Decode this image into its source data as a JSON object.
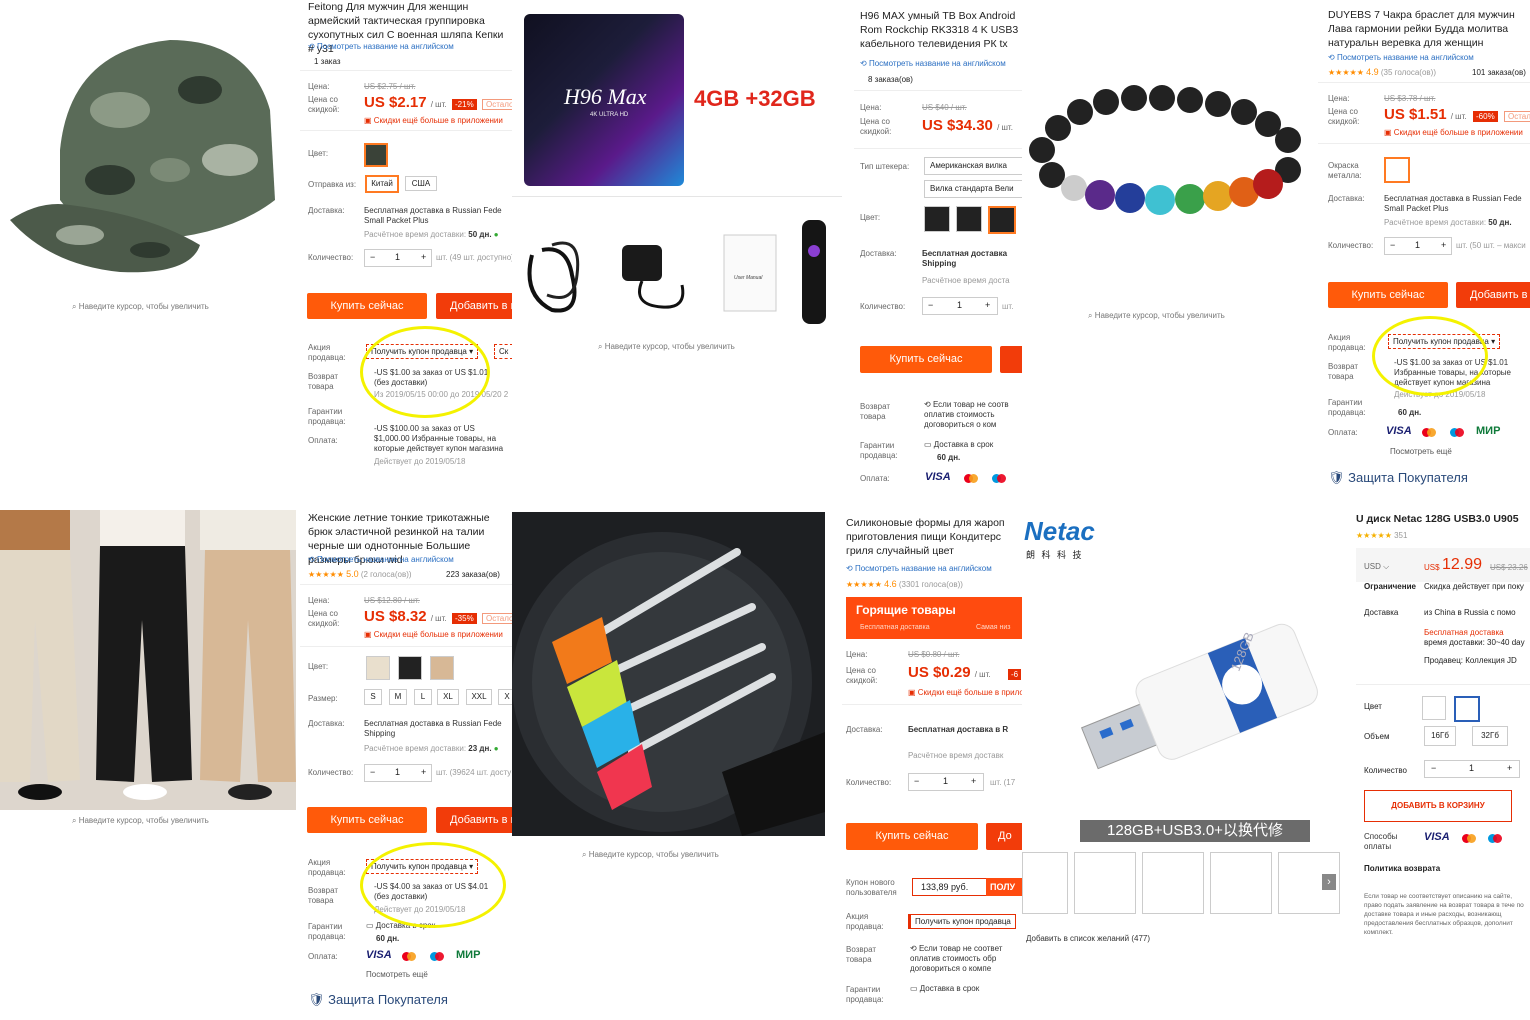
{
  "common": {
    "hover_hint": "Наведите курсор, чтобы увеличить",
    "translate_link": "Посмотреть название на английском",
    "price_label": "Цена:",
    "discount_price_label": "Цена со скидкой:",
    "app_discount": "Скидки ещё больше в приложении",
    "color_label": "Цвет:",
    "delivery_label": "Доставка:",
    "quantity_label": "Количество:",
    "buy_now": "Купить сейчас",
    "add_to_cart": "Добавить в корзину",
    "promo_label": "Акция продавца:",
    "return_label": "Возврат товара",
    "guarantee_label": "Гарантии продавца:",
    "payment_label": "Оплата:",
    "get_coupon": "Получить купон продавца",
    "free_shipping": "Бесплатная доставка в Russian Federation via",
    "estimated": "Расчётное время доставки:",
    "see_more": "Посмотреть ещё",
    "buyer_protection": "Защита Покупателя",
    "pieces_unit": "/ шт.",
    "remaining": "Осталось",
    "qty_value": "1"
  },
  "p1": {
    "title": "Feitong Для мужчин Для женщин армейский тактическая группировка сухопутных сил С военная шляпа Кепки # у31",
    "orders": "1 заказ",
    "old_price": "US $2.75 / шт.",
    "price": "US $2.17",
    "discount": "-21%",
    "ship_from_label": "Отправка из:",
    "ship_from": [
      "Китай",
      "США"
    ],
    "delivery": "Бесплатная доставка в Russian Fede Small Packet Plus",
    "days": "50 дн.",
    "stock": "шт. (49 шт. доступно)",
    "coupon_side": "Ск",
    "coupon1": "-US $1.00 за заказ от US $1.01 (без доставки)",
    "coupon1_date": "Из 2019/05/15 00:00 до 2019/05/20 2",
    "coupon2": "-US $100.00 за заказ от US $1,000.00 Избранные товары, на которые действует купон магазина",
    "coupon2_date": "Действует до 2019/05/18"
  },
  "p2": {
    "brand_line": "H96 Max",
    "brand_sub": "4K ULTRA HD",
    "banner": "4GB +32GB",
    "manual": "User Manual",
    "title": "H96 MAX умный ТВ Box Android Rom Rockchip RK3318 4 K USB3 кабельного телевидения РК tx",
    "orders": "8 заказа(ов)",
    "old_price": "US $40 / шт.",
    "price": "US $34.30",
    "plug_label": "Тип штекера:",
    "plugs": [
      "Американская вилка",
      "Вилка стандарта Вели"
    ],
    "delivery": "Бесплатная доставка Shipping",
    "estimated": "Расчётное время доста",
    "return_text": "Если товар не соотв оплатив стоимость договориться о ком",
    "guarantee_text": "Доставка в срок",
    "guarantee_days": "60 дн."
  },
  "p3": {
    "title": "DUYEBS 7 Чакра браслет для мужчин Лава гармонии рейки Будда молитва натуральн веревка для женщин",
    "rating": "4.9",
    "votes": "(35 голоса(ов))",
    "orders": "101 заказа(ов)",
    "old_price": "US $3.78 / шт.",
    "price": "US $1.51",
    "discount": "-60%",
    "metal_label": "Окраска металла:",
    "delivery": "Бесплатная доставка в Russian Fede Small Packet Plus",
    "days": "50 дн.",
    "stock": "шт. (50 шт. – макси",
    "coupon1": "-US $1.00 за заказ от US $1.01 Избранные товары, на которые действует купон магазина",
    "coupon1_date": "Действует до 2019/05/18",
    "guarantee_days": "60 дн."
  },
  "p4": {
    "title": "Женские летние тонкие трикотажные брюк эластичной резинкой на талии черные ши однотонные Большие размеры брюки wid",
    "rating": "5.0",
    "votes": "(2 голоса(ов))",
    "orders": "223 заказа(ов)",
    "old_price": "US $12.80 / шт.",
    "price": "US $8.32",
    "discount": "-35%",
    "size_label": "Размер:",
    "sizes": [
      "S",
      "M",
      "L",
      "XL",
      "XXL",
      "X"
    ],
    "delivery": "Бесплатная доставка в Russian Fede Shipping",
    "days": "23 дн.",
    "stock": "шт. (39624 шт. досту",
    "coupon1": "-US $4.00 за заказ от US $4.01 (без доставки)",
    "coupon1_date": "Действует до 2019/05/18",
    "guarantee_text": "Доставка в срок",
    "guarantee_days": "60 дн."
  },
  "p5": {
    "title": "Силиконовые формы для жароп приготовления пищи Кондитерс гриля случайный цвет",
    "rating": "4.6",
    "votes": "(3301 голоса(ов))",
    "hot_title": "Горящие товары",
    "hot_sub1": "Бесплатная доставка",
    "hot_sub2": "Самая низ",
    "old_price": "US $0.80 / шт.",
    "price": "US $0.29",
    "discount": "-6",
    "delivery": "Бесплатная доставка в R",
    "estimated": "Расчётное время доставк",
    "stock": "шт. (17",
    "new_user_label": "Купон нового пользователя",
    "new_user_value": "133,89 руб.",
    "new_user_btn": "ПОЛУ",
    "return_text": "Если товар не соответ оплатив стоимость обр договориться о компе",
    "guarantee_text": "Доставка в срок"
  },
  "p6": {
    "logo": "Netac",
    "logo_cn": "朗 科 科 技",
    "banner": "128GB+USB3.0+以换代修",
    "drive_text": "128GB",
    "title": "U диск Netac 128G USB3.0 U905",
    "reviews": "351",
    "currency": "USD",
    "price_prefix": "US$",
    "price": "12.99",
    "old_price": "US$ 23.26",
    "limit_label": "Ограничение",
    "limit_text": "Скидка действует при поку",
    "delivery_label": "Доставка",
    "route": "из China в Russia с помо",
    "free": "Бесплатная доставка",
    "time": "время доставки: 30~40 day",
    "seller": "Продавец: Коллекция JD",
    "color_label": "Цвет",
    "volume_label": "Объем",
    "volumes": [
      "16Гб",
      "32Гб"
    ],
    "qty_label": "Количество",
    "add_cart": "ДОБАВИТЬ В КОРЗИНУ",
    "pay_label": "Способы оплаты",
    "return_policy": "Политика возврата",
    "return_text": "Если товар не соответствует описанию на сайте, право подать заявление на возврат товара в тече по доставке товара и иные расходы, возникающ предоставления бесплатных образцов, дополнит комплект.",
    "wishlist": "Добавить в список желаний (477)"
  },
  "payments": {
    "visa": "VISA",
    "mir": "МИР"
  },
  "colors": {
    "accent": "#ff5a0a",
    "price": "#e62e04",
    "highlight": "#f4f200",
    "link": "#2b6fc2"
  }
}
